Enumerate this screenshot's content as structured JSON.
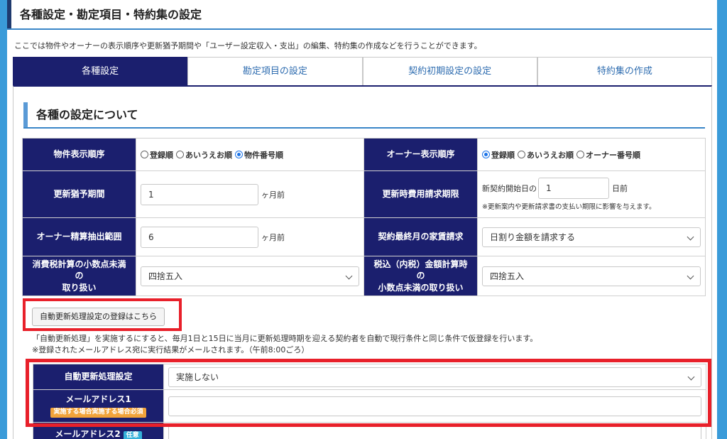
{
  "page": {
    "title": "各種設定・勘定項目・特約集の設定",
    "intro": "ここでは物件やオーナーの表示順序や更新猶予期間や「ユーザー設定収入・支出」の編集、特約集の作成などを行うことができます。"
  },
  "tabs": [
    {
      "label": "各種設定",
      "active": true
    },
    {
      "label": "勘定項目の設定",
      "active": false
    },
    {
      "label": "契約初期設定の設定",
      "active": false
    },
    {
      "label": "特約集の作成",
      "active": false
    }
  ],
  "section": {
    "title": "各種の設定について"
  },
  "settings": {
    "property_order": {
      "label": "物件表示順序",
      "options": [
        "登録順",
        "あいうえお順",
        "物件番号順"
      ],
      "selected": 2
    },
    "owner_order": {
      "label": "オーナー表示順序",
      "options": [
        "登録順",
        "あいうえお順",
        "オーナー番号順"
      ],
      "selected": 0
    },
    "renewal_grace": {
      "label": "更新猶予期間",
      "value": "1",
      "unit": "ヶ月前"
    },
    "renewal_fee_deadline": {
      "label": "更新時費用請求期限",
      "prefix": "新契約開始日の",
      "value": "1",
      "unit": "日前",
      "note": "※更新案内や更新請求書の支払い期限に影響を与えます。"
    },
    "owner_settlement": {
      "label": "オーナー精算抽出範囲",
      "value": "6",
      "unit": "ヶ月前"
    },
    "final_month_rent": {
      "label": "契約最終月の家賃請求",
      "value": "日割り金額を請求する"
    },
    "tax_rounding": {
      "label_line1": "消費税計算の小数点未満の",
      "label_line2": "取り扱い",
      "value": "四捨五入"
    },
    "tax_incl_rounding": {
      "label_line1": "税込（内税）金額計算時の",
      "label_line2": "小数点未満の取り扱い",
      "value": "四捨五入"
    }
  },
  "auto_renewal": {
    "button_label": "自動更新処理設定の登録はこちら",
    "desc_line1": "「自動更新処理」を実施するにすると、毎月1日と15日に当月に更新処理時期を迎える契約者を自動で現行条件と同じ条件で仮登録を行います。",
    "desc_line2": "※登録されたメールアドレス宛に実行結果がメールされます。（午前8:00ごろ）",
    "setting_label": "自動更新処理設定",
    "setting_value": "実施しない",
    "email1_label": "メールアドレス1",
    "email1_badge": "実施する場合実施する場合必須",
    "email1_value": "",
    "email2_label": "メールアドレス2",
    "email2_badge": "任意",
    "email2_value": ""
  },
  "colors": {
    "header_navy": "#1b1f6e",
    "highlight_red": "#e8202a",
    "background_blue": "#3a9bd9",
    "badge_orange": "#f2a33a",
    "badge_cyan": "#35b0d9"
  }
}
